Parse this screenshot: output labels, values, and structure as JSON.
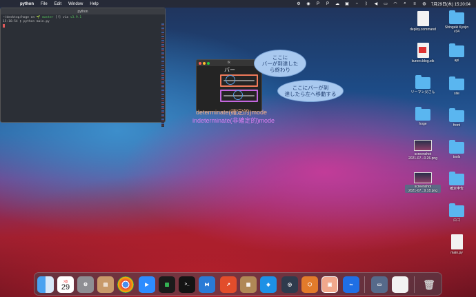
{
  "menubar": {
    "app_name": "python",
    "menus": [
      "File",
      "Edit",
      "Window",
      "Help"
    ],
    "clock": "7月29日(木)  15:20:04",
    "status_icons": [
      "settings-icon",
      "media-icon",
      "p-icon",
      "p-icon",
      "cloud-icon",
      "box-icon",
      "wifi-lock-icon",
      "bluetooth-icon",
      "volume-icon",
      "battery-icon",
      "wifi-icon",
      "search-icon",
      "control-center-icon",
      "siri-icon"
    ]
  },
  "terminal": {
    "title": "python",
    "prompt_path": "~/desktop/hoge",
    "prompt_on": "on",
    "prompt_branch": "master",
    "prompt_status": "[!]",
    "prompt_via": "via",
    "prompt_version": "v3.9.1",
    "command_time": "15:16:54",
    "command": "❯ python main.py"
  },
  "tk_window": {
    "title": "tk",
    "label": "バー",
    "determinate_progress": 0.15,
    "indeterminate_position": 0.45
  },
  "annotations": {
    "bubble1": "ここに\nバーが到達した\nら終わり",
    "bubble2": "ここにバーが到\n達したら左へ移動する",
    "determinate": "determinate(確定的)mode",
    "indeterminate": "indeterminate(非確定的)mode",
    "determinate_color": "#f6b08a",
    "indeterminate_color": "#e07ff2"
  },
  "desktop_icons": [
    {
      "label": "deploy.command",
      "kind": "doc"
    },
    {
      "label": "Shingeki Kyojin\nv34",
      "kind": "folder"
    },
    {
      "label": "kuroro.blog.stk",
      "kind": "doc-red"
    },
    {
      "label": "api",
      "kind": "folder"
    },
    {
      "label": "リーマン父さん",
      "kind": "folder"
    },
    {
      "label": "site",
      "kind": "folder"
    },
    {
      "label": "hoge",
      "kind": "folder"
    },
    {
      "label": "front",
      "kind": "folder"
    },
    {
      "label": "screenshot\n2021-07...0.26.png",
      "kind": "thumb"
    },
    {
      "label": "tools",
      "kind": "folder"
    },
    {
      "label": "screenshot\n2021-07...9.18.png",
      "kind": "thumb"
    },
    {
      "label": "確定申告",
      "kind": "folder"
    },
    {
      "label": "ロゴ",
      "kind": "folder"
    },
    {
      "label": "main.py",
      "kind": "doc"
    }
  ],
  "dock": {
    "calendar_month": "7月",
    "calendar_day": "29",
    "apps": [
      "finder",
      "calendar",
      "system-preferences",
      "contacts",
      "chrome",
      "zoom",
      "activity-monitor",
      "terminal",
      "vscode",
      "instruments",
      "archive",
      "docker",
      "quicktime",
      "sourcetree",
      "preview",
      "infinity",
      "screenshot",
      "document",
      "trash"
    ]
  }
}
